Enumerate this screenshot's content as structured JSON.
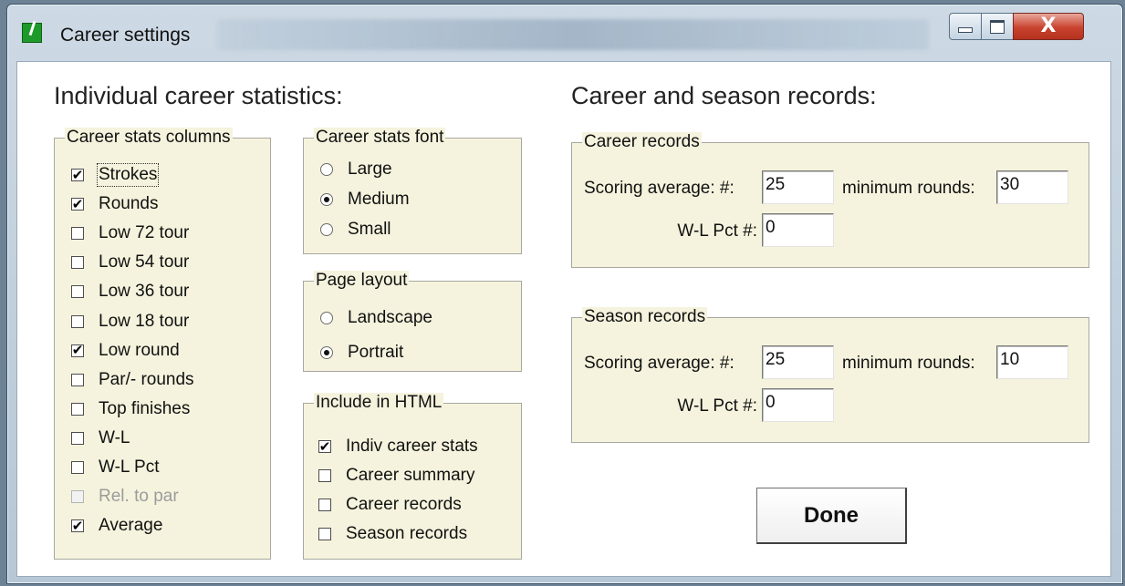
{
  "window": {
    "title": "Career settings",
    "close_glyph": "X"
  },
  "individual": {
    "heading": "Individual career statistics:",
    "columns": {
      "legend": "Career stats columns",
      "items": [
        {
          "label": "Strokes",
          "checked": true
        },
        {
          "label": "Rounds",
          "checked": true
        },
        {
          "label": "Low 72 tour",
          "checked": false
        },
        {
          "label": "Low 54 tour",
          "checked": false
        },
        {
          "label": "Low 36 tour",
          "checked": false
        },
        {
          "label": "Low 18 tour",
          "checked": false
        },
        {
          "label": "Low round",
          "checked": true
        },
        {
          "label": "Par/- rounds",
          "checked": false
        },
        {
          "label": "Top finishes",
          "checked": false
        },
        {
          "label": "W-L",
          "checked": false
        },
        {
          "label": "W-L Pct",
          "checked": false
        },
        {
          "label": "Rel. to par",
          "checked": false,
          "disabled": true
        },
        {
          "label": "Average",
          "checked": true
        }
      ]
    },
    "font": {
      "legend": "Career stats font",
      "options": [
        {
          "label": "Large",
          "selected": false
        },
        {
          "label": "Medium",
          "selected": true
        },
        {
          "label": "Small",
          "selected": false
        }
      ]
    },
    "layout": {
      "legend": "Page layout",
      "options": [
        {
          "label": "Landscape",
          "selected": false
        },
        {
          "label": "Portrait",
          "selected": true
        }
      ]
    },
    "html": {
      "legend": "Include in HTML",
      "items": [
        {
          "label": "Indiv career stats",
          "checked": true
        },
        {
          "label": "Career summary",
          "checked": false
        },
        {
          "label": "Career records",
          "checked": false
        },
        {
          "label": "Season records",
          "checked": false
        }
      ]
    }
  },
  "records": {
    "heading": "Career and season records:",
    "career": {
      "legend": "Career records",
      "scoring_label": "Scoring average: #:",
      "scoring_value": "25",
      "min_rounds_label": "minimum rounds:",
      "min_rounds_value": "30",
      "wl_label": "W-L Pct #:",
      "wl_value": "0"
    },
    "season": {
      "legend": "Season records",
      "scoring_label": "Scoring average: #:",
      "scoring_value": "25",
      "min_rounds_label": "minimum rounds:",
      "min_rounds_value": "10",
      "wl_label": "W-L Pct #:",
      "wl_value": "0"
    }
  },
  "done_label": "Done"
}
